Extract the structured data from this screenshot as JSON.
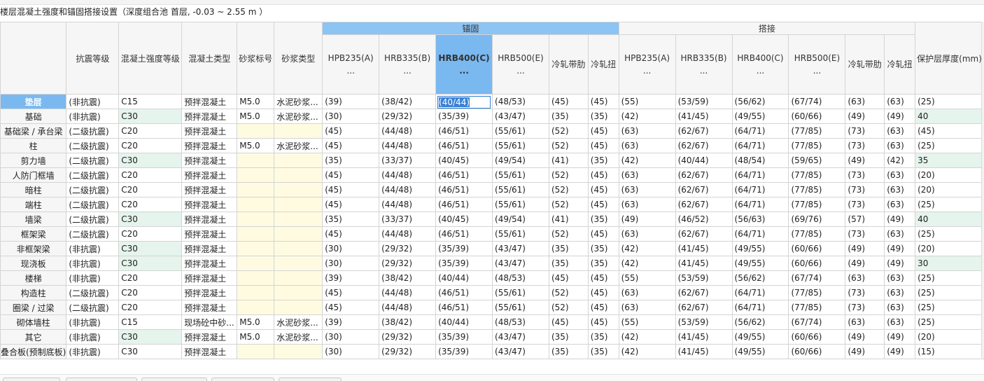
{
  "caption": "楼层混凝土强度和锚固搭接设置（深度组合池  首层, -0.03 ~ 2.55 m ）",
  "group_headers": {
    "anchor": "锚固",
    "lap": "搭接"
  },
  "columns": [
    "抗震等级",
    "混凝土强度等级",
    "混凝土类型",
    "砂浆标号",
    "砂浆类型",
    "HPB235(A)\n...",
    "HRB335(B)\n...",
    "HRB400(C)\n...",
    "HRB500(E)\n...",
    "冷轧带肋",
    "冷轧扭",
    "HPB235(A)\n...",
    "HRB335(B)\n...",
    "HRB400(C)\n...",
    "HRB500(E)\n...",
    "冷轧带肋",
    "冷轧扭",
    "保护层厚度(mm)"
  ],
  "active_cell": {
    "row": 0,
    "col": 7
  },
  "rows": [
    {
      "name": "垫层",
      "cells": [
        "(非抗震)",
        "C15",
        "预拌混凝土",
        "M5.0",
        "水泥砂浆...",
        "(39)",
        "(38/42)",
        "(40/44)",
        "(48/53)",
        "(45)",
        "(45)",
        "(55)",
        "(53/59)",
        "(56/62)",
        "(67/74)",
        "(63)",
        "(63)",
        "(25)"
      ],
      "green": [],
      "yellow": []
    },
    {
      "name": "基础",
      "cells": [
        "(非抗震)",
        "C30",
        "预拌混凝土",
        "M5.0",
        "水泥砂浆...",
        "(30)",
        "(29/32)",
        "(35/39)",
        "(43/47)",
        "(35)",
        "(35)",
        "(42)",
        "(41/45)",
        "(49/55)",
        "(60/66)",
        "(49)",
        "(49)",
        "40"
      ],
      "green": [
        1,
        17
      ],
      "yellow": []
    },
    {
      "name": "基础梁 / 承台梁",
      "cells": [
        "(二级抗震)",
        "C20",
        "预拌混凝土",
        "",
        "",
        "(45)",
        "(44/48)",
        "(46/51)",
        "(55/61)",
        "(52)",
        "(45)",
        "(63)",
        "(62/67)",
        "(64/71)",
        "(77/85)",
        "(73)",
        "(63)",
        "(45)"
      ],
      "green": [],
      "yellow": [
        3,
        4
      ]
    },
    {
      "name": "柱",
      "cells": [
        "(二级抗震)",
        "C20",
        "预拌混凝土",
        "M5.0",
        "水泥砂浆...",
        "(45)",
        "(44/48)",
        "(46/51)",
        "(55/61)",
        "(52)",
        "(45)",
        "(63)",
        "(62/67)",
        "(64/71)",
        "(77/85)",
        "(73)",
        "(63)",
        "(25)"
      ],
      "green": [],
      "yellow": []
    },
    {
      "name": "剪力墙",
      "cells": [
        "(二级抗震)",
        "C30",
        "预拌混凝土",
        "",
        "",
        "(35)",
        "(33/37)",
        "(40/45)",
        "(49/54)",
        "(41)",
        "(35)",
        "(42)",
        "(40/44)",
        "(48/54)",
        "(59/65)",
        "(49)",
        "(42)",
        "35"
      ],
      "green": [
        1,
        17
      ],
      "yellow": [
        3,
        4
      ]
    },
    {
      "name": "人防门框墙",
      "cells": [
        "(二级抗震)",
        "C20",
        "预拌混凝土",
        "",
        "",
        "(45)",
        "(44/48)",
        "(46/51)",
        "(55/61)",
        "(52)",
        "(45)",
        "(63)",
        "(62/67)",
        "(64/71)",
        "(77/85)",
        "(73)",
        "(63)",
        "(20)"
      ],
      "green": [],
      "yellow": [
        3,
        4
      ]
    },
    {
      "name": "暗柱",
      "cells": [
        "(二级抗震)",
        "C20",
        "预拌混凝土",
        "",
        "",
        "(45)",
        "(44/48)",
        "(46/51)",
        "(55/61)",
        "(52)",
        "(45)",
        "(63)",
        "(62/67)",
        "(64/71)",
        "(77/85)",
        "(73)",
        "(63)",
        "(20)"
      ],
      "green": [],
      "yellow": [
        3,
        4
      ]
    },
    {
      "name": "端柱",
      "cells": [
        "(二级抗震)",
        "C20",
        "预拌混凝土",
        "",
        "",
        "(45)",
        "(44/48)",
        "(46/51)",
        "(55/61)",
        "(52)",
        "(45)",
        "(63)",
        "(62/67)",
        "(64/71)",
        "(77/85)",
        "(73)",
        "(63)",
        "(25)"
      ],
      "green": [],
      "yellow": [
        3,
        4
      ]
    },
    {
      "name": "墙梁",
      "cells": [
        "(二级抗震)",
        "C30",
        "预拌混凝土",
        "",
        "",
        "(35)",
        "(33/37)",
        "(40/45)",
        "(49/54)",
        "(41)",
        "(35)",
        "(49)",
        "(46/52)",
        "(56/63)",
        "(69/76)",
        "(57)",
        "(49)",
        "40"
      ],
      "green": [
        1,
        17
      ],
      "yellow": [
        3,
        4
      ]
    },
    {
      "name": "框架梁",
      "cells": [
        "(二级抗震)",
        "C20",
        "预拌混凝土",
        "",
        "",
        "(45)",
        "(44/48)",
        "(46/51)",
        "(55/61)",
        "(52)",
        "(45)",
        "(63)",
        "(62/67)",
        "(64/71)",
        "(77/85)",
        "(73)",
        "(63)",
        "(25)"
      ],
      "green": [],
      "yellow": [
        3,
        4
      ]
    },
    {
      "name": "非框架梁",
      "cells": [
        "(非抗震)",
        "C30",
        "预拌混凝土",
        "",
        "",
        "(30)",
        "(29/32)",
        "(35/39)",
        "(43/47)",
        "(35)",
        "(35)",
        "(42)",
        "(41/45)",
        "(49/55)",
        "(60/66)",
        "(49)",
        "(49)",
        "(20)"
      ],
      "green": [
        1
      ],
      "yellow": [
        3,
        4
      ]
    },
    {
      "name": "现浇板",
      "cells": [
        "(非抗震)",
        "C30",
        "预拌混凝土",
        "",
        "",
        "(30)",
        "(29/32)",
        "(35/39)",
        "(43/47)",
        "(35)",
        "(35)",
        "(42)",
        "(41/45)",
        "(49/55)",
        "(60/66)",
        "(49)",
        "(49)",
        "30"
      ],
      "green": [
        1,
        17
      ],
      "yellow": [
        3,
        4
      ]
    },
    {
      "name": "楼梯",
      "cells": [
        "(非抗震)",
        "C20",
        "预拌混凝土",
        "",
        "",
        "(39)",
        "(38/42)",
        "(40/44)",
        "(48/53)",
        "(45)",
        "(45)",
        "(55)",
        "(53/59)",
        "(56/62)",
        "(67/74)",
        "(63)",
        "(63)",
        "(25)"
      ],
      "green": [],
      "yellow": [
        3,
        4
      ]
    },
    {
      "name": "构造柱",
      "cells": [
        "(二级抗震)",
        "C20",
        "预拌混凝土",
        "",
        "",
        "(45)",
        "(44/48)",
        "(46/51)",
        "(55/61)",
        "(52)",
        "(45)",
        "(63)",
        "(62/67)",
        "(64/71)",
        "(77/85)",
        "(73)",
        "(63)",
        "(25)"
      ],
      "green": [],
      "yellow": [
        3,
        4
      ]
    },
    {
      "name": "圈梁 / 过梁",
      "cells": [
        "(二级抗震)",
        "C20",
        "预拌混凝土",
        "",
        "",
        "(45)",
        "(44/48)",
        "(46/51)",
        "(55/61)",
        "(52)",
        "(45)",
        "(63)",
        "(62/67)",
        "(64/71)",
        "(77/85)",
        "(73)",
        "(63)",
        "(25)"
      ],
      "green": [],
      "yellow": [
        3,
        4
      ]
    },
    {
      "name": "砌体墙柱",
      "cells": [
        "(非抗震)",
        "C15",
        "现场砼中砂...",
        "M5.0",
        "水泥砂浆...",
        "(39)",
        "(38/42)",
        "(40/44)",
        "(48/53)",
        "(45)",
        "(45)",
        "(55)",
        "(53/59)",
        "(56/62)",
        "(67/74)",
        "(63)",
        "(63)",
        "(25)"
      ],
      "green": [],
      "yellow": []
    },
    {
      "name": "其它",
      "cells": [
        "(非抗震)",
        "C30",
        "预拌混凝土",
        "M5.0",
        "水泥砂浆...",
        "(30)",
        "(29/32)",
        "(35/39)",
        "(43/47)",
        "(35)",
        "(35)",
        "(42)",
        "(41/45)",
        "(49/55)",
        "(60/66)",
        "(49)",
        "(49)",
        "(20)"
      ],
      "green": [
        1
      ],
      "yellow": []
    },
    {
      "name": "叠合板(预制底板)",
      "cells": [
        "(非抗震)",
        "C30",
        "预拌混凝土",
        "",
        "",
        "(30)",
        "(29/32)",
        "(35/39)",
        "(43/47)",
        "(35)",
        "(35)",
        "(42)",
        "(41/45)",
        "(49/55)",
        "(60/66)",
        "(49)",
        "(49)",
        "(15)"
      ],
      "green": [],
      "yellow": [
        3,
        4
      ]
    }
  ]
}
